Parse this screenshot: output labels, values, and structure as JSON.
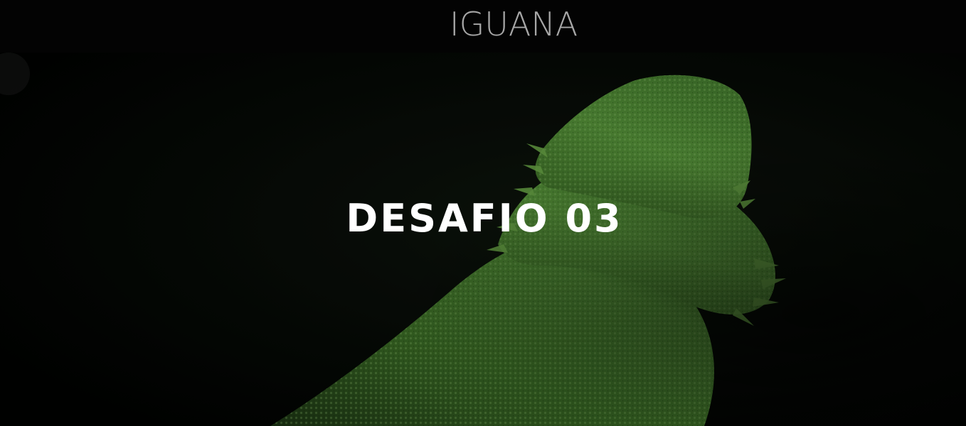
{
  "header": {
    "logo_text": "IGUANA"
  },
  "hero": {
    "image_subject": "green-lizard-photo",
    "title": "DESAFIO 03"
  },
  "colors": {
    "header_bg": "#030303",
    "logo_text": "#a7a7a7",
    "hero_title": "#ffffff",
    "lizard_green": "#4f8a32"
  }
}
